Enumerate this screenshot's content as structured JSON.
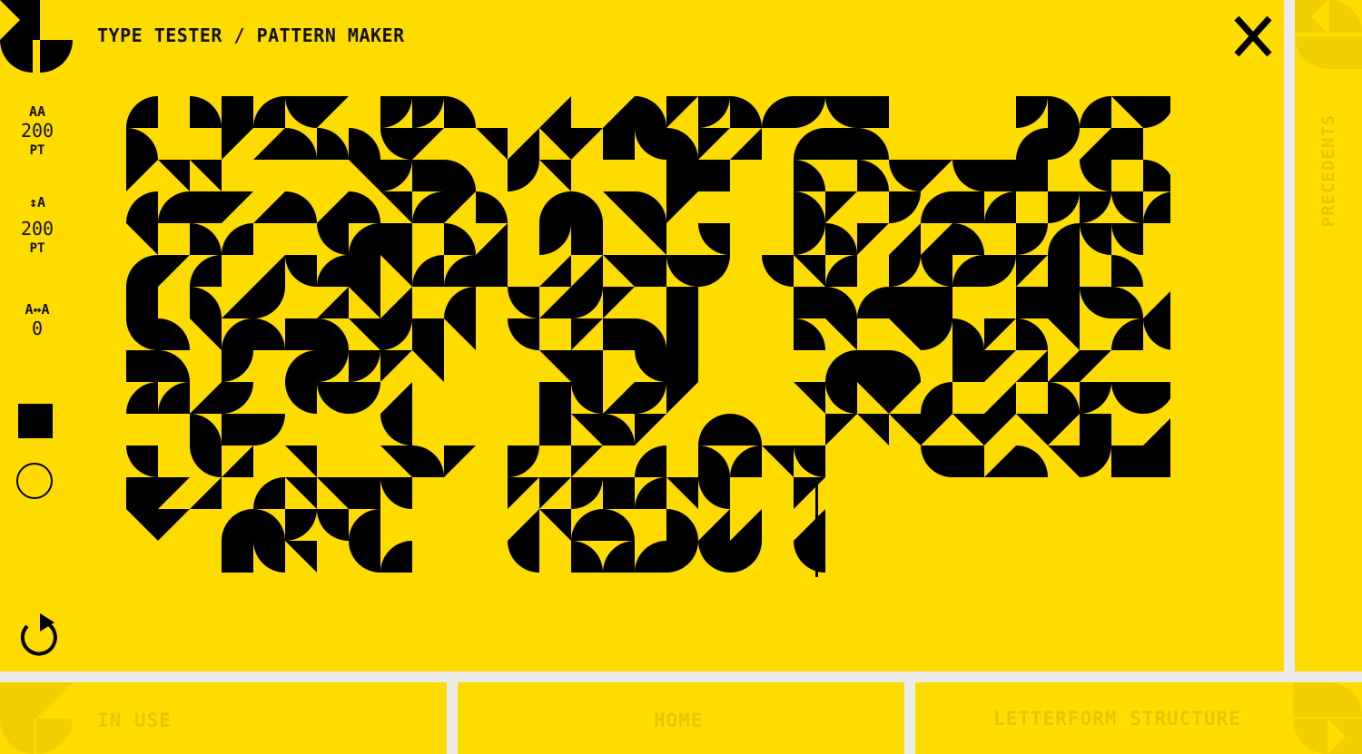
{
  "header": {
    "title": "TYPE TESTER / PATTERN MAKER",
    "close_label": "X"
  },
  "controls": {
    "size": {
      "icon": "AA",
      "value": "200",
      "unit": "PT"
    },
    "leading": {
      "icon": "↕A",
      "value": "200",
      "unit": "PT"
    },
    "tracking": {
      "icon": "A↔A",
      "value": "0"
    }
  },
  "nav": {
    "side": "PRECEDENTS",
    "in_use": "IN USE",
    "home": "HOME",
    "structure": "LETTERFORM STRUCTURE"
  },
  "colors": {
    "background": "#ffdc00",
    "ink": "#000000",
    "muted": "#e8c400",
    "gutter": "#ebebeb"
  },
  "icons": [
    "logo-icon",
    "close-icon",
    "font-size-icon",
    "leading-icon",
    "tracking-icon",
    "square-shape-icon",
    "circle-shape-icon",
    "reset-icon"
  ]
}
